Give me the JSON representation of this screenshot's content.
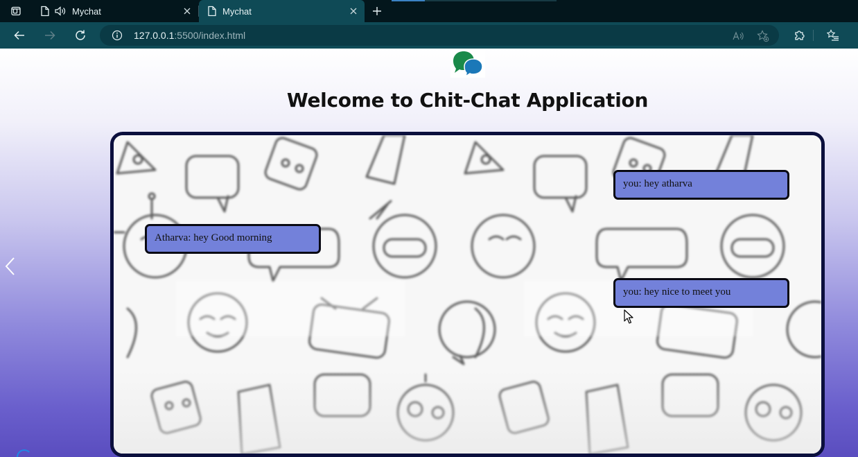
{
  "browser": {
    "tabs": [
      {
        "title": "Mychat",
        "active": false,
        "audio": true
      },
      {
        "title": "Mychat",
        "active": true,
        "audio": false
      }
    ],
    "address": {
      "host": "127.0.0.1",
      "path": ":5500/index.html"
    }
  },
  "page": {
    "heading": "Welcome to Chit-Chat Application",
    "messages": [
      {
        "text": "Atharva: hey Good morning",
        "side": "left"
      },
      {
        "text": "you: hey atharva",
        "side": "right"
      },
      {
        "text": "you: hey nice to meet you",
        "side": "right"
      }
    ]
  },
  "icons": {
    "tab_actions": "tab-actions-icon",
    "page": "page-icon",
    "audio": "speaker-icon",
    "close": "close-icon",
    "new_tab": "plus-icon",
    "back": "back-arrow-icon",
    "forward": "forward-arrow-icon",
    "refresh": "refresh-icon",
    "info": "info-icon",
    "read_aloud": "read-aloud-icon",
    "favorite": "favorite-star-icon",
    "extensions": "puzzle-icon",
    "favorites": "favorites-list-icon",
    "logo": "chat-bubbles-logo",
    "chevron": "chevron-left-icon"
  },
  "colors": {
    "toolbar": "#0f4a56",
    "bubble": "#7381da",
    "chat_border": "#0b0f3d",
    "logo_green": "#1a8a4a",
    "logo_blue": "#1b78b8"
  }
}
